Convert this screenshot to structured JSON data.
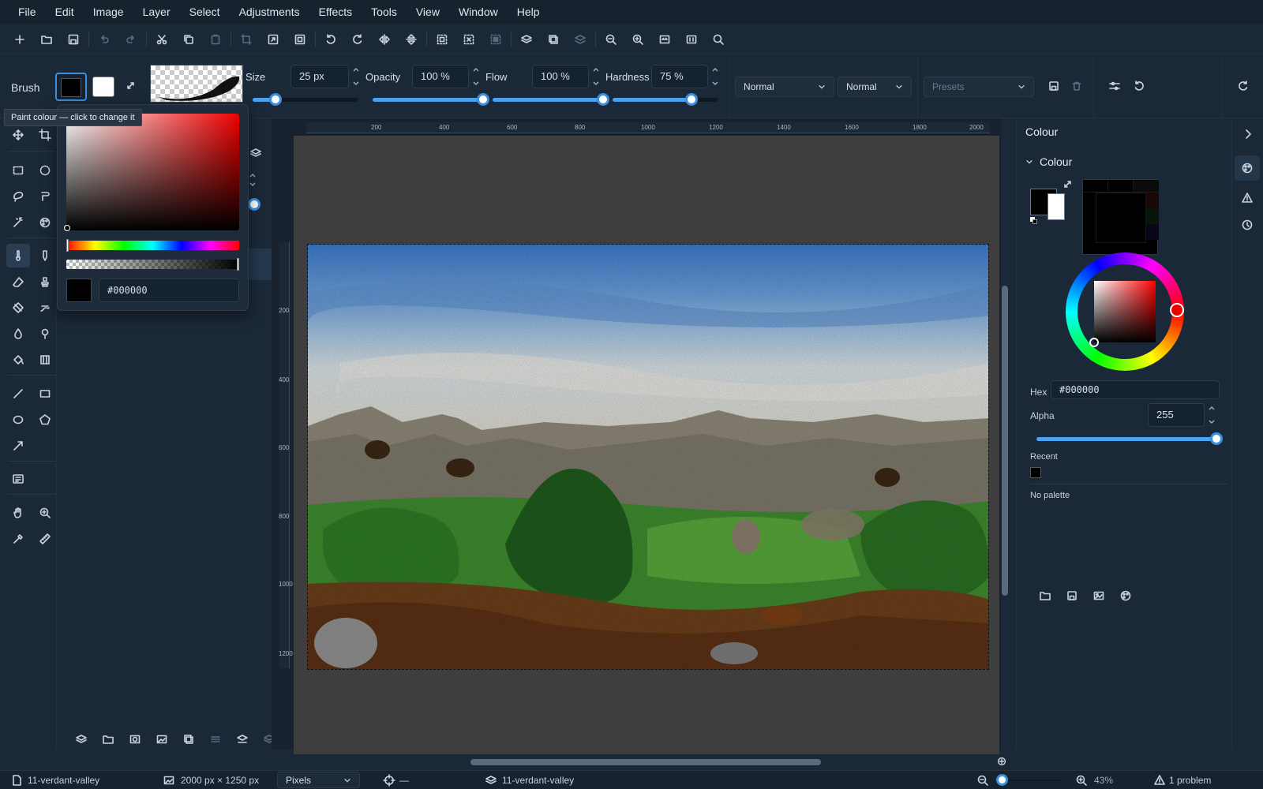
{
  "menu": [
    "File",
    "Edit",
    "Image",
    "Layer",
    "Select",
    "Adjustments",
    "Effects",
    "Tools",
    "View",
    "Window",
    "Help"
  ],
  "options": {
    "tool_name": "Brush",
    "size_label": "Size",
    "size_value": "25 px",
    "opacity_label": "Opacity",
    "opacity_value": "100 %",
    "opacity_level": 1.0,
    "flow_label": "Flow",
    "flow_value": "100 %",
    "flow_level": 1.0,
    "hardness_label": "Hardness",
    "hardness_value": "75 %",
    "hardness_level": 0.75,
    "blend_mode_1": "Normal",
    "blend_mode_2": "Normal",
    "presets_placeholder": "Presets"
  },
  "tooltip": "Paint colour — click to change it",
  "popup": {
    "hex": "#000000"
  },
  "ruler": {
    "h": [
      "200",
      "400",
      "600",
      "800",
      "1000",
      "1200",
      "1400",
      "1600",
      "1800",
      "2000"
    ],
    "v": [
      "200",
      "400",
      "600",
      "800",
      "1000",
      "1200"
    ]
  },
  "colour_panel": {
    "panel_title": "Colour",
    "section_title": "Colour",
    "hex_label": "Hex",
    "hex_value": "#000000",
    "alpha_label": "Alpha",
    "alpha_value": "255",
    "recent_label": "Recent",
    "palette_text": "No palette"
  },
  "status": {
    "document": "11-verdant-valley",
    "size": "2000 px × 1250 px",
    "units": "Pixels",
    "cursor": "—",
    "layer": "11-verdant-valley",
    "zoom": "43%",
    "problems": "1 problem"
  },
  "colors": {
    "accent": "#4aa3f0",
    "primary": "#000000",
    "secondary": "#ffffff"
  }
}
